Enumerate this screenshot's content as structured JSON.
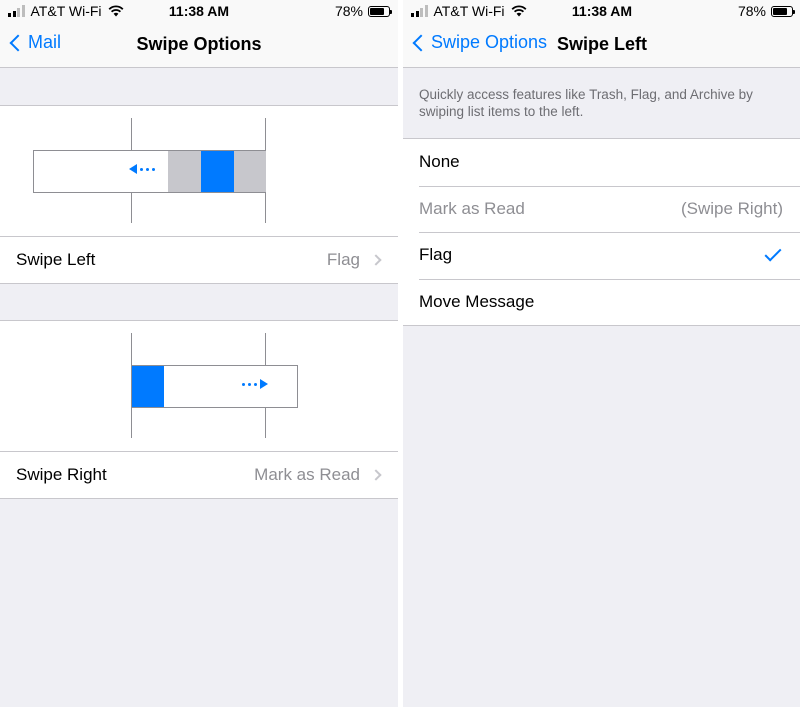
{
  "colors": {
    "accent": "#007aff",
    "swipe_gray": "#c7c7cc"
  },
  "left_screen": {
    "status": {
      "carrier": "AT&T Wi-Fi",
      "time": "11:38 AM",
      "battery": "78%",
      "battery_level": 0.78
    },
    "nav": {
      "back_label": "Mail",
      "title": "Swipe Options"
    },
    "swipe_left": {
      "label": "Swipe Left",
      "value": "Flag"
    },
    "swipe_right": {
      "label": "Swipe Right",
      "value": "Mark as Read"
    }
  },
  "right_screen": {
    "status": {
      "carrier": "AT&T Wi-Fi",
      "time": "11:38 AM",
      "battery": "78%",
      "battery_level": 0.78
    },
    "nav": {
      "back_label": "Swipe Options",
      "title": "Swipe Left"
    },
    "footer": "Quickly access features like Trash, Flag, and Archive by swiping list items to the left.",
    "options": [
      {
        "label": "None",
        "detail": "",
        "selected": false
      },
      {
        "label": "Mark as Read",
        "detail": "(Swipe Right)",
        "selected": false
      },
      {
        "label": "Flag",
        "detail": "",
        "selected": true
      },
      {
        "label": "Move Message",
        "detail": "",
        "selected": false
      }
    ]
  }
}
